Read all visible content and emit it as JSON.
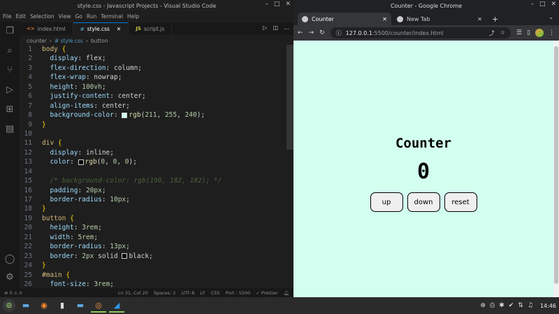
{
  "vscode": {
    "title": "style.css - Javascript Projects - Visual Studio Code",
    "menu": [
      "File",
      "Edit",
      "Selection",
      "View",
      "Go",
      "Run",
      "Terminal",
      "Help"
    ],
    "tabs": [
      {
        "label": "index.html",
        "icon": "<>"
      },
      {
        "label": "style.css",
        "icon": "#"
      },
      {
        "label": "script.js",
        "icon": "JS"
      }
    ],
    "breadcrumb": [
      "counter",
      "#  style.css",
      "button"
    ],
    "status": {
      "problems": "⊗ 0 ⚠ 0",
      "position": "Ln 31, Col 20",
      "spaces": "Spaces: 2",
      "encoding": "UTF-8",
      "eol": "LF",
      "language": "CSS",
      "port": "Port : 5500",
      "prettier": "✓ Prettier"
    },
    "lines": [
      "1",
      "2",
      "3",
      "4",
      "5",
      "6",
      "7",
      "8",
      "9",
      "10",
      "11",
      "12",
      "13",
      "14",
      "15",
      "16",
      "17",
      "18",
      "19",
      "20",
      "21",
      "22",
      "23",
      "24",
      "25",
      "26"
    ]
  },
  "chrome": {
    "title": "Counter - Google Chrome",
    "tabs": [
      {
        "label": "Counter"
      },
      {
        "label": "New Tab"
      }
    ],
    "url_host": "127.0.0.1",
    "url_path": ":5500/counter/index.html"
  },
  "page": {
    "heading": "Counter",
    "count": "0",
    "buttons": [
      "up",
      "down",
      "reset"
    ],
    "background": "#d3fff0"
  },
  "taskbar": {
    "clock": "14:46"
  }
}
